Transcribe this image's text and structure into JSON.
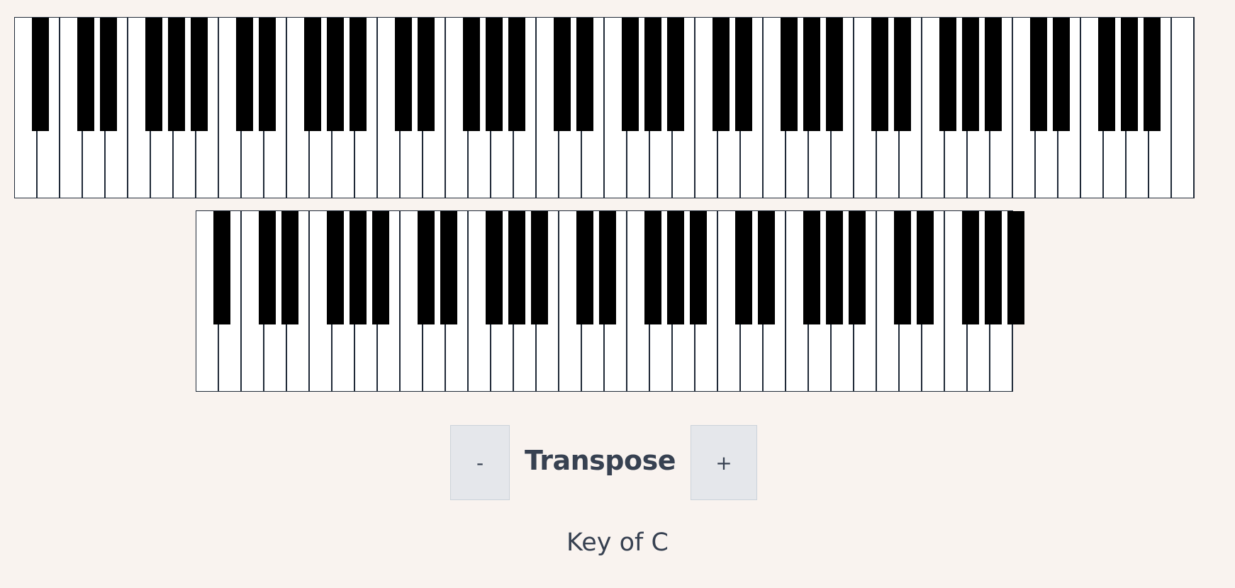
{
  "keyboards": [
    {
      "name": "upper",
      "white_keys": 52,
      "black_keys": 36
    },
    {
      "name": "lower",
      "white_keys": 36,
      "black_keys": 26
    }
  ],
  "controls": {
    "decrease_label": "-",
    "title": "Transpose",
    "increase_label": "+"
  },
  "status": {
    "key_label": "Key of C"
  },
  "colors": {
    "background": "#f9f3ef",
    "white_key": "#ffffff",
    "black_key": "#000000",
    "key_border": "#1f2937",
    "button_bg": "#e5e7eb",
    "text": "#374151"
  }
}
